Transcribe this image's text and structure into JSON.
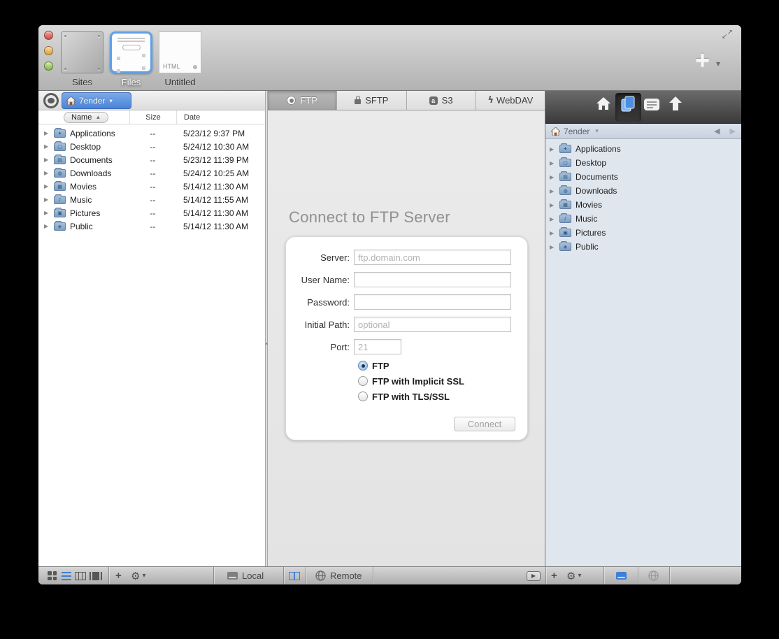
{
  "window": {
    "traffic_lights": [
      "close",
      "minimize",
      "zoom"
    ],
    "doc_tabs": [
      {
        "label": "Sites",
        "selected": false
      },
      {
        "label": "Files",
        "selected": true
      },
      {
        "label": "Untitled",
        "selected": false,
        "badge": "HTML"
      }
    ],
    "add_tab_label": "+"
  },
  "icons": {
    "chevron_down": "▾",
    "disclosure": "▶",
    "back": "◀",
    "forward": "▶",
    "sort_asc": "▲",
    "plus": "+",
    "gear": "⚙",
    "play": "▶",
    "expand_ne": "↗",
    "expand_sw": "↙",
    "s3_glyph": "a",
    "webdav_glyph": "ϟ"
  },
  "left_panel": {
    "location": "7ender",
    "columns": {
      "name": "Name",
      "size": "Size",
      "date": "Date"
    },
    "rows": [
      {
        "name": "Applications",
        "size": "--",
        "date": "5/23/12 9:37 PM",
        "glyph": "✦"
      },
      {
        "name": "Desktop",
        "size": "--",
        "date": "5/24/12 10:30 AM",
        "glyph": "▢"
      },
      {
        "name": "Documents",
        "size": "--",
        "date": "5/23/12 11:39 PM",
        "glyph": "▤"
      },
      {
        "name": "Downloads",
        "size": "--",
        "date": "5/24/12 10:25 AM",
        "glyph": "◍"
      },
      {
        "name": "Movies",
        "size": "--",
        "date": "5/14/12 11:30 AM",
        "glyph": "▦"
      },
      {
        "name": "Music",
        "size": "--",
        "date": "5/14/12 11:55 AM",
        "glyph": "♪"
      },
      {
        "name": "Pictures",
        "size": "--",
        "date": "5/14/12 11:30 AM",
        "glyph": "▣"
      },
      {
        "name": "Public",
        "size": "--",
        "date": "5/14/12 11:30 AM",
        "glyph": "◈"
      }
    ]
  },
  "center_panel": {
    "tabs": [
      {
        "label": "FTP",
        "selected": true
      },
      {
        "label": "SFTP",
        "selected": false
      },
      {
        "label": "S3",
        "selected": false
      },
      {
        "label": "WebDAV",
        "selected": false
      }
    ],
    "title": "Connect to FTP Server",
    "form": {
      "fields": [
        {
          "label": "Server:",
          "placeholder": "ftp.domain.com",
          "value": ""
        },
        {
          "label": "User Name:",
          "placeholder": "",
          "value": ""
        },
        {
          "label": "Password:",
          "placeholder": "",
          "value": ""
        },
        {
          "label": "Initial Path:",
          "placeholder": "optional",
          "value": ""
        },
        {
          "label": "Port:",
          "placeholder": "21",
          "value": ""
        }
      ],
      "radios": [
        {
          "label": "FTP",
          "selected": true
        },
        {
          "label": "FTP with Implicit SSL",
          "selected": false
        },
        {
          "label": "FTP with TLS/SSL",
          "selected": false
        }
      ],
      "submit_label": "Connect",
      "submit_enabled": false
    }
  },
  "right_panel": {
    "location": "7ender",
    "rows": [
      {
        "label": "Applications",
        "glyph": "✦"
      },
      {
        "label": "Desktop",
        "glyph": "▢"
      },
      {
        "label": "Documents",
        "glyph": "▤"
      },
      {
        "label": "Downloads",
        "glyph": "◍"
      },
      {
        "label": "Movies",
        "glyph": "▦"
      },
      {
        "label": "Music",
        "glyph": "♪"
      },
      {
        "label": "Pictures",
        "glyph": "▣"
      },
      {
        "label": "Public",
        "glyph": "◈"
      }
    ]
  },
  "bottom_bar": {
    "local_label": "Local",
    "remote_label": "Remote"
  },
  "colors": {
    "accent_blue": "#4a90e2",
    "breadcrumb_blue": "#5590dd",
    "selection_border_blue": "#5ea1e8",
    "dark_toolbar": "#3c3c3c",
    "right_panel_bg": "#e0e6ee",
    "window_chrome": "#c9c9c9"
  }
}
